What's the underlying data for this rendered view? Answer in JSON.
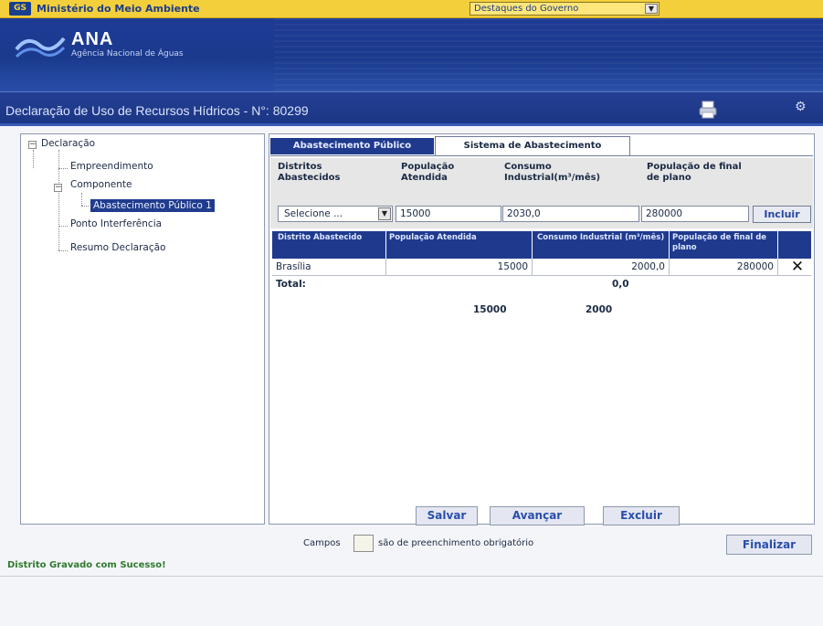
{
  "gov_bar": {
    "logo_text": "GS",
    "ministry": "Ministério do Meio Ambiente",
    "highlights_select": "Destaques do Governo"
  },
  "banner": {
    "title": "ANA",
    "subtitle": "Agência Nacional de Águas"
  },
  "page": {
    "title": "Declaração de Uso de Recursos Hídricos - N°: 80299"
  },
  "tree": {
    "root": "Declaração",
    "items": [
      {
        "label": "Empreendimento"
      },
      {
        "label": "Componente"
      },
      {
        "label": "Abastecimento Público 1",
        "selected": true
      },
      {
        "label": "Ponto Interferência"
      },
      {
        "label": "Resumo Declaração"
      }
    ]
  },
  "tabs": [
    {
      "label": "Abastecimento Público",
      "active": false
    },
    {
      "label": "Sistema de Abastecimento",
      "active": true
    }
  ],
  "form": {
    "headers": {
      "distritos": "Distritos Abastecidos",
      "populacao": "População Atendida",
      "consumo": "Consumo Industrial(m³/mês)",
      "final": "População de final de plano"
    },
    "values": {
      "distrito_select": "Selecione ...",
      "populacao": "15000",
      "consumo": "2030,0",
      "final": "280000"
    },
    "incluir_label": "Incluir"
  },
  "grid": {
    "headers": [
      "Distrito Abastecido",
      "População Atendida",
      "Consumo Industrial (m³/mês)",
      "População de final de plano"
    ],
    "rows": [
      {
        "distrito": "Brasília",
        "populacao": "15000",
        "consumo": "2000,0",
        "final": "280000"
      }
    ],
    "total_label": "Total:",
    "total_value": "0,0",
    "sum_populacao": "15000",
    "sum_consumo": "2000"
  },
  "actions": {
    "salvar": "Salvar",
    "avancar": "Avançar",
    "excluir": "Excluir"
  },
  "footer": {
    "campos_label": "Campos",
    "required_text": "são de preenchimento obrigatório",
    "finalizar": "Finalizar",
    "status_message": "Distrito Gravado com Sucesso!"
  },
  "colors": {
    "gov_yellow": "#f3cf3c",
    "banner_blue": "#1e3b94",
    "selection_blue": "#213c8d",
    "success_green": "#2f7a2f"
  }
}
